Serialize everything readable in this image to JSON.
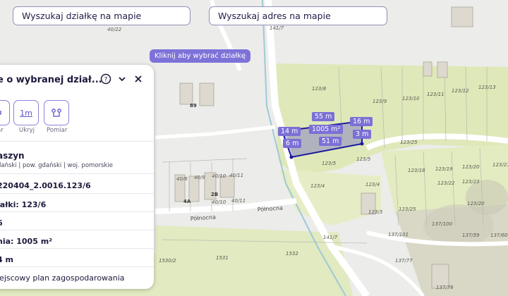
{
  "search": {
    "parcel_placeholder": "Wyszukaj działkę na mapie",
    "address_placeholder": "Wyszukaj adres na mapie"
  },
  "hint": "Kliknij aby wybrać działkę",
  "panel": {
    "title": "e o wybranej dział...",
    "tools": [
      {
        "label": "ar",
        "icon": "ruler-icon"
      },
      {
        "label": "Ukryj",
        "icon": "hide-dimensions-icon",
        "text": "1m"
      },
      {
        "label": "Pomiar",
        "icon": "measure-points-icon"
      }
    ],
    "locality": "aszyn",
    "admin": "dański | pow. gdański | woj. pomorskie",
    "id_line": "220404_2.0016.123/6",
    "parcel_line": "iałki: 123/6",
    "line5": "6",
    "area_line": "nia: 1005 m²",
    "line7": "4 m",
    "line8": "iejscowy plan zagospodarowania"
  },
  "measurements": {
    "top": "55 m",
    "area": "1005 m²",
    "bottom": "51 m",
    "left_outer": "14 m",
    "left_inner": "6 m",
    "right_top": "16 m",
    "right_bottom": "3 m"
  },
  "map_labels": {
    "parcels": [
      "40/22",
      "141/7",
      "123/8",
      "123/9",
      "123/10",
      "123/11",
      "123/12",
      "123/13",
      "123/25",
      "123/5",
      "123/4",
      "123/18",
      "123/19",
      "123/20",
      "123/21",
      "123/22",
      "123/23",
      "123/3",
      "137/101",
      "137/100",
      "137/59",
      "137/60",
      "137/77",
      "137/6",
      "40/8",
      "40/9",
      "40/10",
      "40/11",
      "1532",
      "1531",
      "1530/2",
      "137/76"
    ],
    "buildings": [
      "89",
      "2B",
      "4A"
    ],
    "street": "Północna"
  },
  "colors": {
    "accent": "#7b70d6",
    "parcel_outline": "#1b1aa0"
  }
}
